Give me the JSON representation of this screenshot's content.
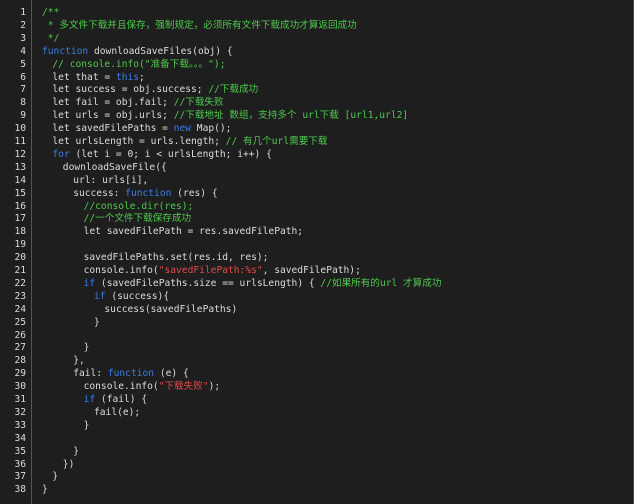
{
  "editor": {
    "colors": {
      "background": "#1e1e1e",
      "plain": "#dcdcdc",
      "comment": "#4ec94e",
      "keyword": "#3a7ce8",
      "string": "#e24a4a"
    },
    "lines": [
      {
        "n": "1",
        "ind": 0,
        "t": [
          {
            "c": "g",
            "s": "/**"
          }
        ]
      },
      {
        "n": "2",
        "ind": 0,
        "t": [
          {
            "c": "g",
            "s": " * 多文件下载并且保存，强制规定，必须所有文件下载成功才算返回成功"
          }
        ]
      },
      {
        "n": "3",
        "ind": 0,
        "t": [
          {
            "c": "g",
            "s": " */"
          }
        ]
      },
      {
        "n": "4",
        "ind": 0,
        "t": [
          {
            "c": "k",
            "s": "function"
          },
          {
            "c": "p",
            "s": " downloadSaveFiles(obj) {"
          }
        ]
      },
      {
        "n": "5",
        "ind": 1,
        "t": [
          {
            "c": "g",
            "s": "// console.info(\"准备下载。。。\");"
          }
        ]
      },
      {
        "n": "6",
        "ind": 1,
        "t": [
          {
            "c": "p",
            "s": "let that = "
          },
          {
            "c": "k",
            "s": "this"
          },
          {
            "c": "p",
            "s": ";"
          }
        ]
      },
      {
        "n": "7",
        "ind": 1,
        "t": [
          {
            "c": "p",
            "s": "let success = obj.success; "
          },
          {
            "c": "g",
            "s": "//下载成功"
          }
        ]
      },
      {
        "n": "8",
        "ind": 1,
        "t": [
          {
            "c": "p",
            "s": "let fail = obj.fail; "
          },
          {
            "c": "g",
            "s": "//下载失败"
          }
        ]
      },
      {
        "n": "9",
        "ind": 1,
        "t": [
          {
            "c": "p",
            "s": "let urls = obj.urls; "
          },
          {
            "c": "g",
            "s": "//下载地址 数组，支持多个 url下载 [url1,url2]"
          }
        ]
      },
      {
        "n": "10",
        "ind": 1,
        "t": [
          {
            "c": "p",
            "s": "let savedFilePaths = "
          },
          {
            "c": "k",
            "s": "new"
          },
          {
            "c": "p",
            "s": " Map();"
          }
        ]
      },
      {
        "n": "11",
        "ind": 1,
        "t": [
          {
            "c": "p",
            "s": "let urlsLength = urls.length; "
          },
          {
            "c": "g",
            "s": "// 有几个url需要下载"
          }
        ]
      },
      {
        "n": "12",
        "ind": 1,
        "t": [
          {
            "c": "k",
            "s": "for"
          },
          {
            "c": "p",
            "s": " (let i = 0; i < urlsLength; i++) {"
          }
        ]
      },
      {
        "n": "13",
        "ind": 2,
        "t": [
          {
            "c": "p",
            "s": "downloadSaveFile({"
          }
        ]
      },
      {
        "n": "14",
        "ind": 3,
        "t": [
          {
            "c": "p",
            "s": "url: urls[i],"
          }
        ]
      },
      {
        "n": "15",
        "ind": 3,
        "t": [
          {
            "c": "p",
            "s": "success: "
          },
          {
            "c": "k",
            "s": "function"
          },
          {
            "c": "p",
            "s": " (res) {"
          }
        ]
      },
      {
        "n": "16",
        "ind": 4,
        "t": [
          {
            "c": "g",
            "s": "//console.dir(res);"
          }
        ]
      },
      {
        "n": "17",
        "ind": 4,
        "t": [
          {
            "c": "g",
            "s": "//一个文件下载保存成功"
          }
        ]
      },
      {
        "n": "18",
        "ind": 4,
        "t": [
          {
            "c": "p",
            "s": "let savedFilePath = res.savedFilePath;"
          }
        ]
      },
      {
        "n": "19",
        "ind": 0,
        "t": []
      },
      {
        "n": "20",
        "ind": 4,
        "t": [
          {
            "c": "p",
            "s": "savedFilePaths.set(res.id, res);"
          }
        ]
      },
      {
        "n": "21",
        "ind": 4,
        "t": [
          {
            "c": "p",
            "s": "console.info("
          },
          {
            "c": "r",
            "s": "\"savedFilePath:%s\""
          },
          {
            "c": "p",
            "s": ", savedFilePath);"
          }
        ]
      },
      {
        "n": "22",
        "ind": 4,
        "t": [
          {
            "c": "k",
            "s": "if"
          },
          {
            "c": "p",
            "s": " (savedFilePaths.size == urlsLength) { "
          },
          {
            "c": "g",
            "s": "//如果所有的url 才算成功"
          }
        ]
      },
      {
        "n": "23",
        "ind": 5,
        "t": [
          {
            "c": "k",
            "s": "if"
          },
          {
            "c": "p",
            "s": " (success){"
          }
        ]
      },
      {
        "n": "24",
        "ind": 6,
        "t": [
          {
            "c": "p",
            "s": "success(savedFilePaths)"
          }
        ]
      },
      {
        "n": "25",
        "ind": 5,
        "t": [
          {
            "c": "p",
            "s": "}"
          }
        ]
      },
      {
        "n": "26",
        "ind": 0,
        "t": []
      },
      {
        "n": "27",
        "ind": 4,
        "t": [
          {
            "c": "p",
            "s": "}"
          }
        ]
      },
      {
        "n": "28",
        "ind": 3,
        "t": [
          {
            "c": "p",
            "s": "},"
          }
        ]
      },
      {
        "n": "29",
        "ind": 3,
        "t": [
          {
            "c": "p",
            "s": "fail: "
          },
          {
            "c": "k",
            "s": "function"
          },
          {
            "c": "p",
            "s": " (e) {"
          }
        ]
      },
      {
        "n": "30",
        "ind": 4,
        "t": [
          {
            "c": "p",
            "s": "console.info("
          },
          {
            "c": "r",
            "s": "\"下载失败\""
          },
          {
            "c": "p",
            "s": ");"
          }
        ]
      },
      {
        "n": "31",
        "ind": 4,
        "t": [
          {
            "c": "k",
            "s": "if"
          },
          {
            "c": "p",
            "s": " (fail) {"
          }
        ]
      },
      {
        "n": "32",
        "ind": 5,
        "t": [
          {
            "c": "p",
            "s": "fail(e);"
          }
        ]
      },
      {
        "n": "33",
        "ind": 4,
        "t": [
          {
            "c": "p",
            "s": "}"
          }
        ]
      },
      {
        "n": "34",
        "ind": 0,
        "t": []
      },
      {
        "n": "35",
        "ind": 3,
        "t": [
          {
            "c": "p",
            "s": "}"
          }
        ]
      },
      {
        "n": "36",
        "ind": 2,
        "t": [
          {
            "c": "p",
            "s": "})"
          }
        ]
      },
      {
        "n": "37",
        "ind": 1,
        "t": [
          {
            "c": "p",
            "s": "}"
          }
        ]
      },
      {
        "n": "38",
        "ind": 0,
        "t": [
          {
            "c": "p",
            "s": "}"
          }
        ]
      }
    ]
  }
}
